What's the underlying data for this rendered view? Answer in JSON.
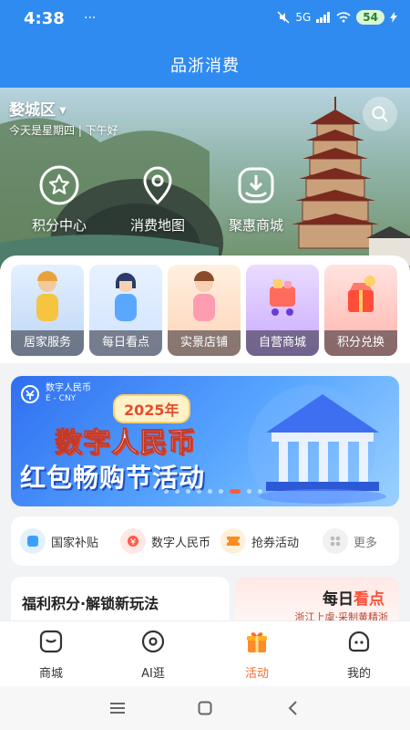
{
  "status": {
    "time": "4:38",
    "dots": "···",
    "network": "5G",
    "battery": "54"
  },
  "header": {
    "title": "品浙消费"
  },
  "hero": {
    "location": "婺城区",
    "greeting": "今天是星期四 | 下午好",
    "actions": [
      {
        "label": "积分中心",
        "icon": "star-badge-icon"
      },
      {
        "label": "消费地图",
        "icon": "map-pin-icon"
      },
      {
        "label": "聚惠商城",
        "icon": "download-bag-icon"
      }
    ]
  },
  "categories": [
    {
      "label": "居家服务",
      "color": "#f5c542"
    },
    {
      "label": "每日看点",
      "color": "#5aa7ff"
    },
    {
      "label": "实景店铺",
      "color": "#ff9db0"
    },
    {
      "label": "自营商城",
      "color": "#b77cff"
    },
    {
      "label": "积分兑换",
      "color": "#ff6b5c"
    }
  ],
  "banner": {
    "ecny_cn": "数字人民币",
    "ecny_en": "E - CNY",
    "year": "2025年",
    "title_line1": "数字人民币",
    "title_line2": "红包畅购节活动",
    "page_count": 9,
    "active_index": 6
  },
  "quick_links": [
    {
      "label": "国家补贴",
      "icon": "subsidy-icon"
    },
    {
      "label": "数字人民币",
      "icon": "ecny-icon"
    },
    {
      "label": "抢券活动",
      "icon": "coupon-icon"
    },
    {
      "label": "更多",
      "icon": "more-grid-icon"
    }
  ],
  "promo": {
    "left_title": "福利积分·解锁新玩法",
    "right_title_a": "每日",
    "right_title_b": "看点",
    "right_sub": "浙江上虞·采制黄精浙"
  },
  "tabs": [
    {
      "label": "商城",
      "active": false
    },
    {
      "label": "AI逛",
      "active": false
    },
    {
      "label": "活动",
      "active": true
    },
    {
      "label": "我的",
      "active": false
    }
  ],
  "colors": {
    "brand_blue": "#2f8bf0",
    "active_orange": "#ff6a2a"
  }
}
